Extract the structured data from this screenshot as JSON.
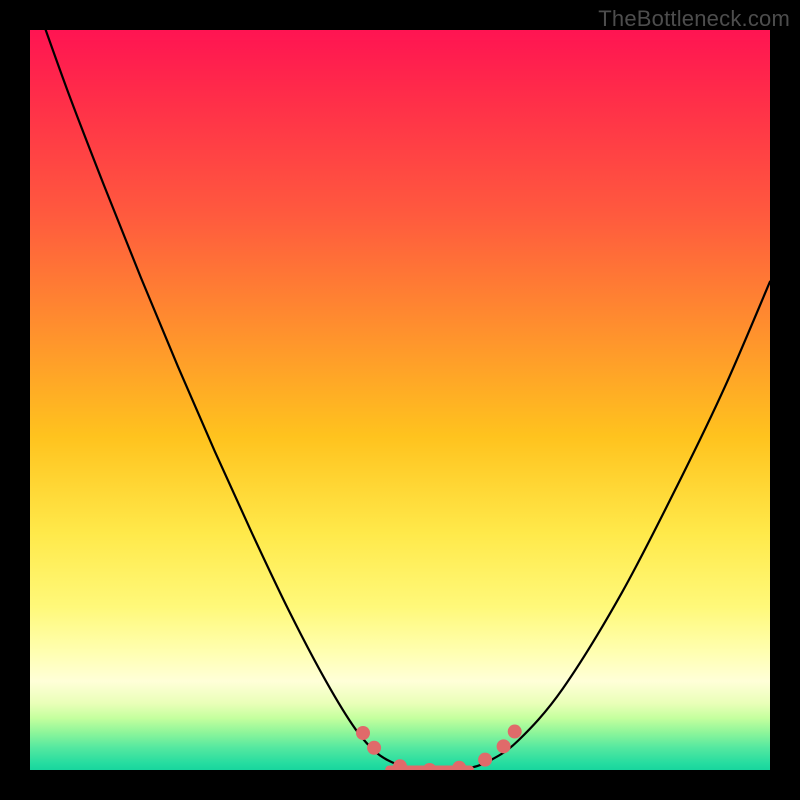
{
  "watermark": "TheBottleneck.com",
  "chart_data": {
    "type": "line",
    "title": "",
    "xlabel": "",
    "ylabel": "",
    "xlim": [
      0,
      1
    ],
    "ylim": [
      0,
      1
    ],
    "series": [
      {
        "name": "curve",
        "x": [
          0.0,
          0.05,
          0.1,
          0.15,
          0.2,
          0.25,
          0.3,
          0.35,
          0.4,
          0.44,
          0.47,
          0.5,
          0.53,
          0.56,
          0.59,
          0.62,
          0.66,
          0.72,
          0.8,
          0.88,
          0.94,
          1.0
        ],
        "y": [
          1.06,
          0.92,
          0.79,
          0.665,
          0.545,
          0.43,
          0.32,
          0.215,
          0.12,
          0.055,
          0.022,
          0.006,
          0.0,
          0.0,
          0.002,
          0.012,
          0.04,
          0.11,
          0.24,
          0.395,
          0.52,
          0.66
        ]
      }
    ],
    "markers": {
      "name": "highlight-dots",
      "color": "#e06a6a",
      "x": [
        0.45,
        0.465,
        0.5,
        0.54,
        0.58,
        0.615,
        0.64,
        0.655
      ],
      "y": [
        0.05,
        0.03,
        0.005,
        0.0,
        0.003,
        0.014,
        0.032,
        0.052
      ]
    },
    "bottom_band": {
      "name": "valley-band",
      "color": "#e06a6a",
      "x_start": 0.48,
      "x_end": 0.6,
      "y": 0.0,
      "thickness": 0.012
    }
  }
}
